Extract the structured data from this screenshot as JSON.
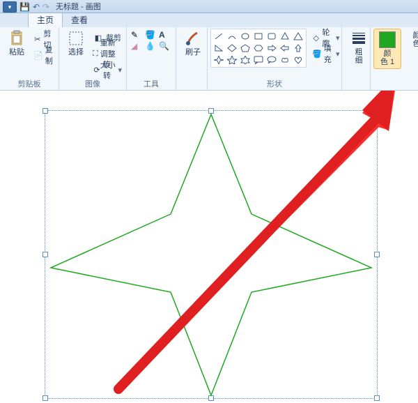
{
  "title": "无标题 - 画图",
  "tabs": {
    "home": "主页",
    "view": "查看"
  },
  "clipboard": {
    "paste": "粘贴",
    "cut": "剪切",
    "copy": "复制",
    "label": "剪贴板"
  },
  "image": {
    "select": "选择",
    "crop": "裁剪",
    "resize": "重新调整大小",
    "rotate": "旋转",
    "label": "图像"
  },
  "tools": {
    "label": "工具",
    "brushes": "刷子"
  },
  "shapes": {
    "outline": "轮廓",
    "fill": "填充",
    "label": "形状"
  },
  "stroke": {
    "label": "粗\n细"
  },
  "colors": {
    "color1": "颜\n色 1",
    "color2": "颜\n色"
  }
}
